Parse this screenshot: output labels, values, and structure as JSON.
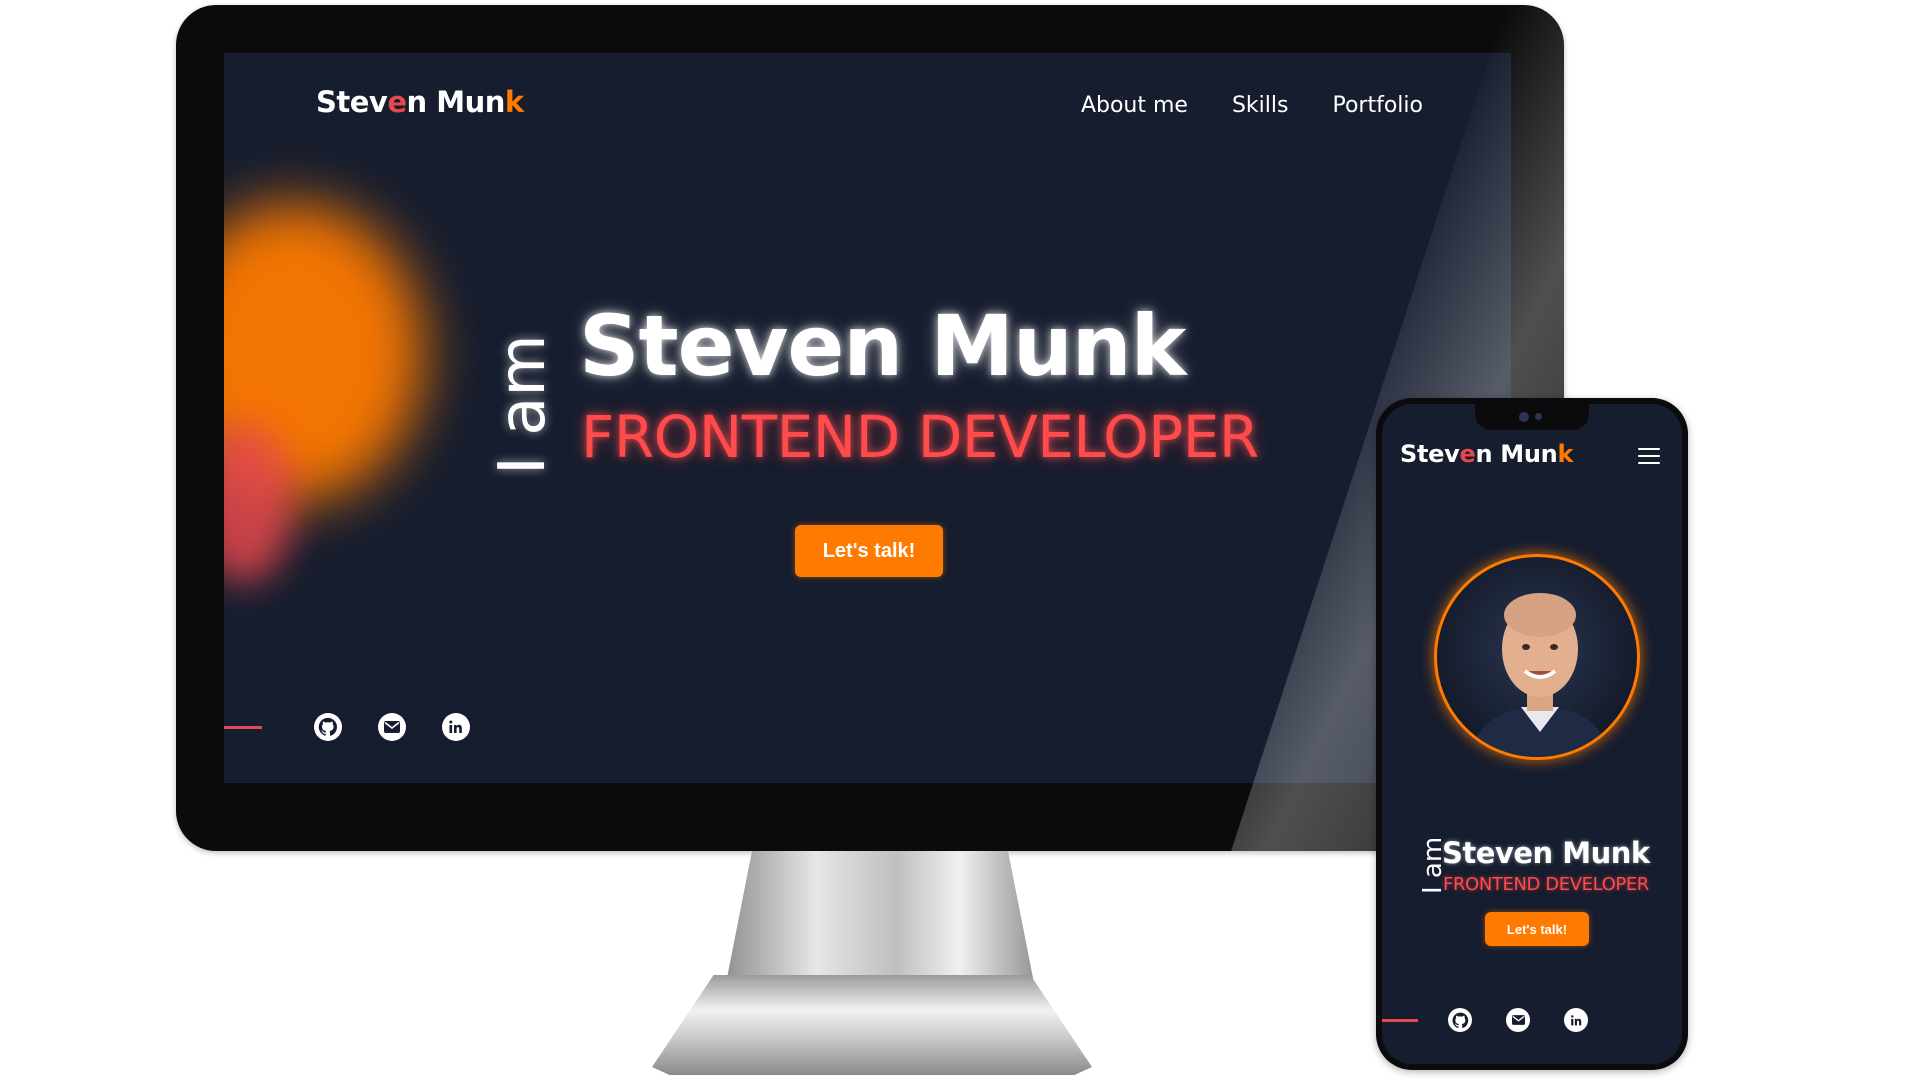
{
  "desktop": {
    "logo": {
      "part1": "Stev",
      "e": "e",
      "part2": "n Mun",
      "k": "k"
    },
    "nav": [
      "About me",
      "Skills",
      "Portfolio"
    ],
    "hero": {
      "prefix": "I am",
      "name": "Steven Munk",
      "role": "FRONTEND DEVELOPER",
      "cta": "Let's talk!"
    },
    "socials": [
      "github-icon",
      "email-icon",
      "linkedin-icon"
    ]
  },
  "mobile": {
    "logo": {
      "part1": "Stev",
      "e": "e",
      "part2": "n Mun",
      "k": "k"
    },
    "hero": {
      "prefix": "I am",
      "name": "Steven Munk",
      "role": "FRONTEND DEVELOPER",
      "cta": "Let's talk!"
    },
    "socials": [
      "github-icon",
      "email-icon",
      "linkedin-icon"
    ]
  },
  "colors": {
    "background": "#161d2e",
    "accent_orange": "#ff7a00",
    "accent_red": "#ff4b4b",
    "text": "#ffffff"
  }
}
